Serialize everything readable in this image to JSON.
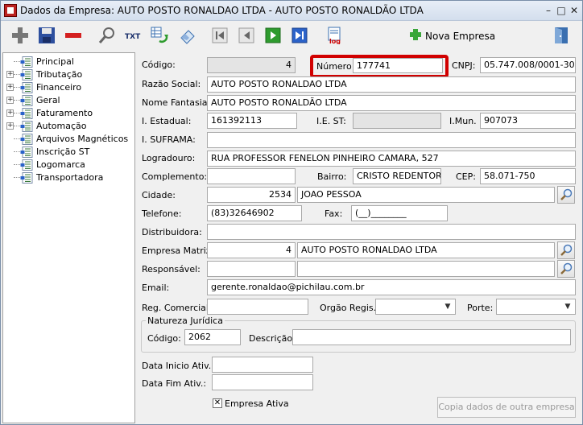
{
  "window": {
    "title": "Dados da Empresa: AUTO POSTO RONALDAO LTDA - AUTO POSTO RONALDÃO LTDA",
    "minimize": "–",
    "maximize": "□",
    "close": "✕"
  },
  "toolbar": {
    "nova_empresa_label": "Nova Empresa",
    "txt_label": "TXT",
    "log_label": "log"
  },
  "tree": {
    "items": [
      {
        "label": "Principal",
        "expandable": false
      },
      {
        "label": "Tributação",
        "expandable": true
      },
      {
        "label": "Financeiro",
        "expandable": true
      },
      {
        "label": "Geral",
        "expandable": true
      },
      {
        "label": "Faturamento",
        "expandable": true
      },
      {
        "label": "Automação",
        "expandable": true
      },
      {
        "label": "Arquivos Magnéticos",
        "expandable": false
      },
      {
        "label": "Inscrição ST",
        "expandable": false
      },
      {
        "label": "Logomarca",
        "expandable": false
      },
      {
        "label": "Transportadora",
        "expandable": false
      }
    ]
  },
  "form": {
    "codigo_label": "Código:",
    "codigo_value": "4",
    "numero_label": "Número:",
    "numero_value": "177741",
    "cnpj_label": "CNPJ:",
    "cnpj_value": "05.747.008/0001-30",
    "razao_label": "Razão Social:",
    "razao_value": "AUTO POSTO RONALDAO LTDA",
    "fantasia_label": "Nome Fantasia:",
    "fantasia_value": "AUTO POSTO RONALDÃO LTDA",
    "ie_label": "I. Estadual:",
    "ie_value": "161392113",
    "iest_label": "I.E. ST:",
    "iest_value": "",
    "imun_label": "I.Mun.",
    "imun_value": "907073",
    "suframa_label": "I. SUFRAMA:",
    "suframa_value": "",
    "logradouro_label": "Logradouro:",
    "logradouro_value": "RUA PROFESSOR FENELON PINHEIRO CAMARA, 527",
    "complemento_label": "Complemento:",
    "complemento_value": "",
    "bairro_label": "Bairro:",
    "bairro_value": "CRISTO REDENTOR",
    "cep_label": "CEP:",
    "cep_value": "58.071-750",
    "cidade_label": "Cidade:",
    "cidade_code": "2534",
    "cidade_name": "JOAO PESSOA",
    "telefone_label": "Telefone:",
    "telefone_value": "(83)32646902",
    "fax_label": "Fax:",
    "fax_value": "(__)________",
    "distribuidora_label": "Distribuidora:",
    "distribuidora_value": "",
    "matriz_label": "Empresa Matriz:",
    "matriz_code": "4",
    "matriz_name": "AUTO POSTO RONALDAO LTDA",
    "responsavel_label": "Responsável:",
    "responsavel_code": "",
    "responsavel_name": "",
    "email_label": "Email:",
    "email_value": "gerente.ronaldao@pichilau.com.br",
    "regcomercial_label": "Reg. Comercial:",
    "regcomercial_value": "",
    "orgao_label": "Orgão Regis.:",
    "orgao_value": "",
    "porte_label": "Porte:",
    "porte_value": "",
    "natureza_title": "Natureza Jurídica",
    "nat_codigo_label": "Código:",
    "nat_codigo_value": "2062",
    "nat_descricao_label": "Descrição:",
    "nat_descricao_value": "",
    "inicio_label": "Data Inicio Ativ.:",
    "inicio_value": "",
    "fim_label": "Data Fim Ativ.:",
    "fim_value": "",
    "ativa_label": "Empresa Ativa",
    "ativa_checked": "✕",
    "copy_button": "Copia dados de outra empresa"
  },
  "colors": {
    "highlight": "#d10000",
    "nav_green": "#2e9b2e",
    "nav_blue": "#2a62c9"
  }
}
